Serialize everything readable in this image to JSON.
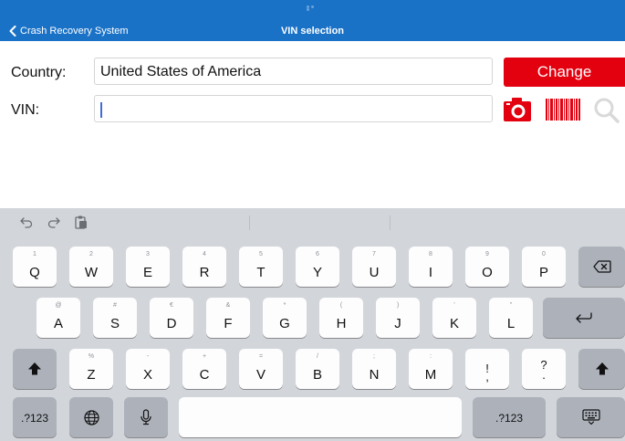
{
  "navbar": {
    "back_label": "Crash Recovery System",
    "title": "VIN selection"
  },
  "form": {
    "country_label": "Country:",
    "country_value": "United States of America",
    "change_label": "Change",
    "vin_label": "VIN:",
    "vin_value": ""
  },
  "colors": {
    "navbar": "#1a72c7",
    "accent": "#e3000f",
    "keyboard_bg": "#d2d5da"
  },
  "toolbar_icons": [
    "undo-icon",
    "redo-icon",
    "paste-icon"
  ],
  "keyboard": {
    "row1": [
      {
        "sec": "1",
        "pri": "Q"
      },
      {
        "sec": "2",
        "pri": "W"
      },
      {
        "sec": "3",
        "pri": "E"
      },
      {
        "sec": "4",
        "pri": "R"
      },
      {
        "sec": "5",
        "pri": "T"
      },
      {
        "sec": "6",
        "pri": "Y"
      },
      {
        "sec": "7",
        "pri": "U"
      },
      {
        "sec": "8",
        "pri": "I"
      },
      {
        "sec": "9",
        "pri": "O"
      },
      {
        "sec": "0",
        "pri": "P"
      }
    ],
    "row2": [
      {
        "sec": "@",
        "pri": "A"
      },
      {
        "sec": "#",
        "pri": "S"
      },
      {
        "sec": "€",
        "pri": "D"
      },
      {
        "sec": "&",
        "pri": "F"
      },
      {
        "sec": "*",
        "pri": "G"
      },
      {
        "sec": "(",
        "pri": "H"
      },
      {
        "sec": ")",
        "pri": "J"
      },
      {
        "sec": "'",
        "pri": "K"
      },
      {
        "sec": "\"",
        "pri": "L"
      }
    ],
    "row3": [
      {
        "sec": "%",
        "pri": "Z"
      },
      {
        "sec": "-",
        "pri": "X"
      },
      {
        "sec": "+",
        "pri": "C"
      },
      {
        "sec": "=",
        "pri": "V"
      },
      {
        "sec": "/",
        "pri": "B"
      },
      {
        "sec": ";",
        "pri": "N"
      },
      {
        "sec": ":",
        "pri": "M"
      },
      {
        "sec": "!",
        "pri": ","
      },
      {
        "sec": "?",
        "pri": "."
      }
    ],
    "numbers_label": ".?123",
    "numbers_label_right": ".?123"
  }
}
